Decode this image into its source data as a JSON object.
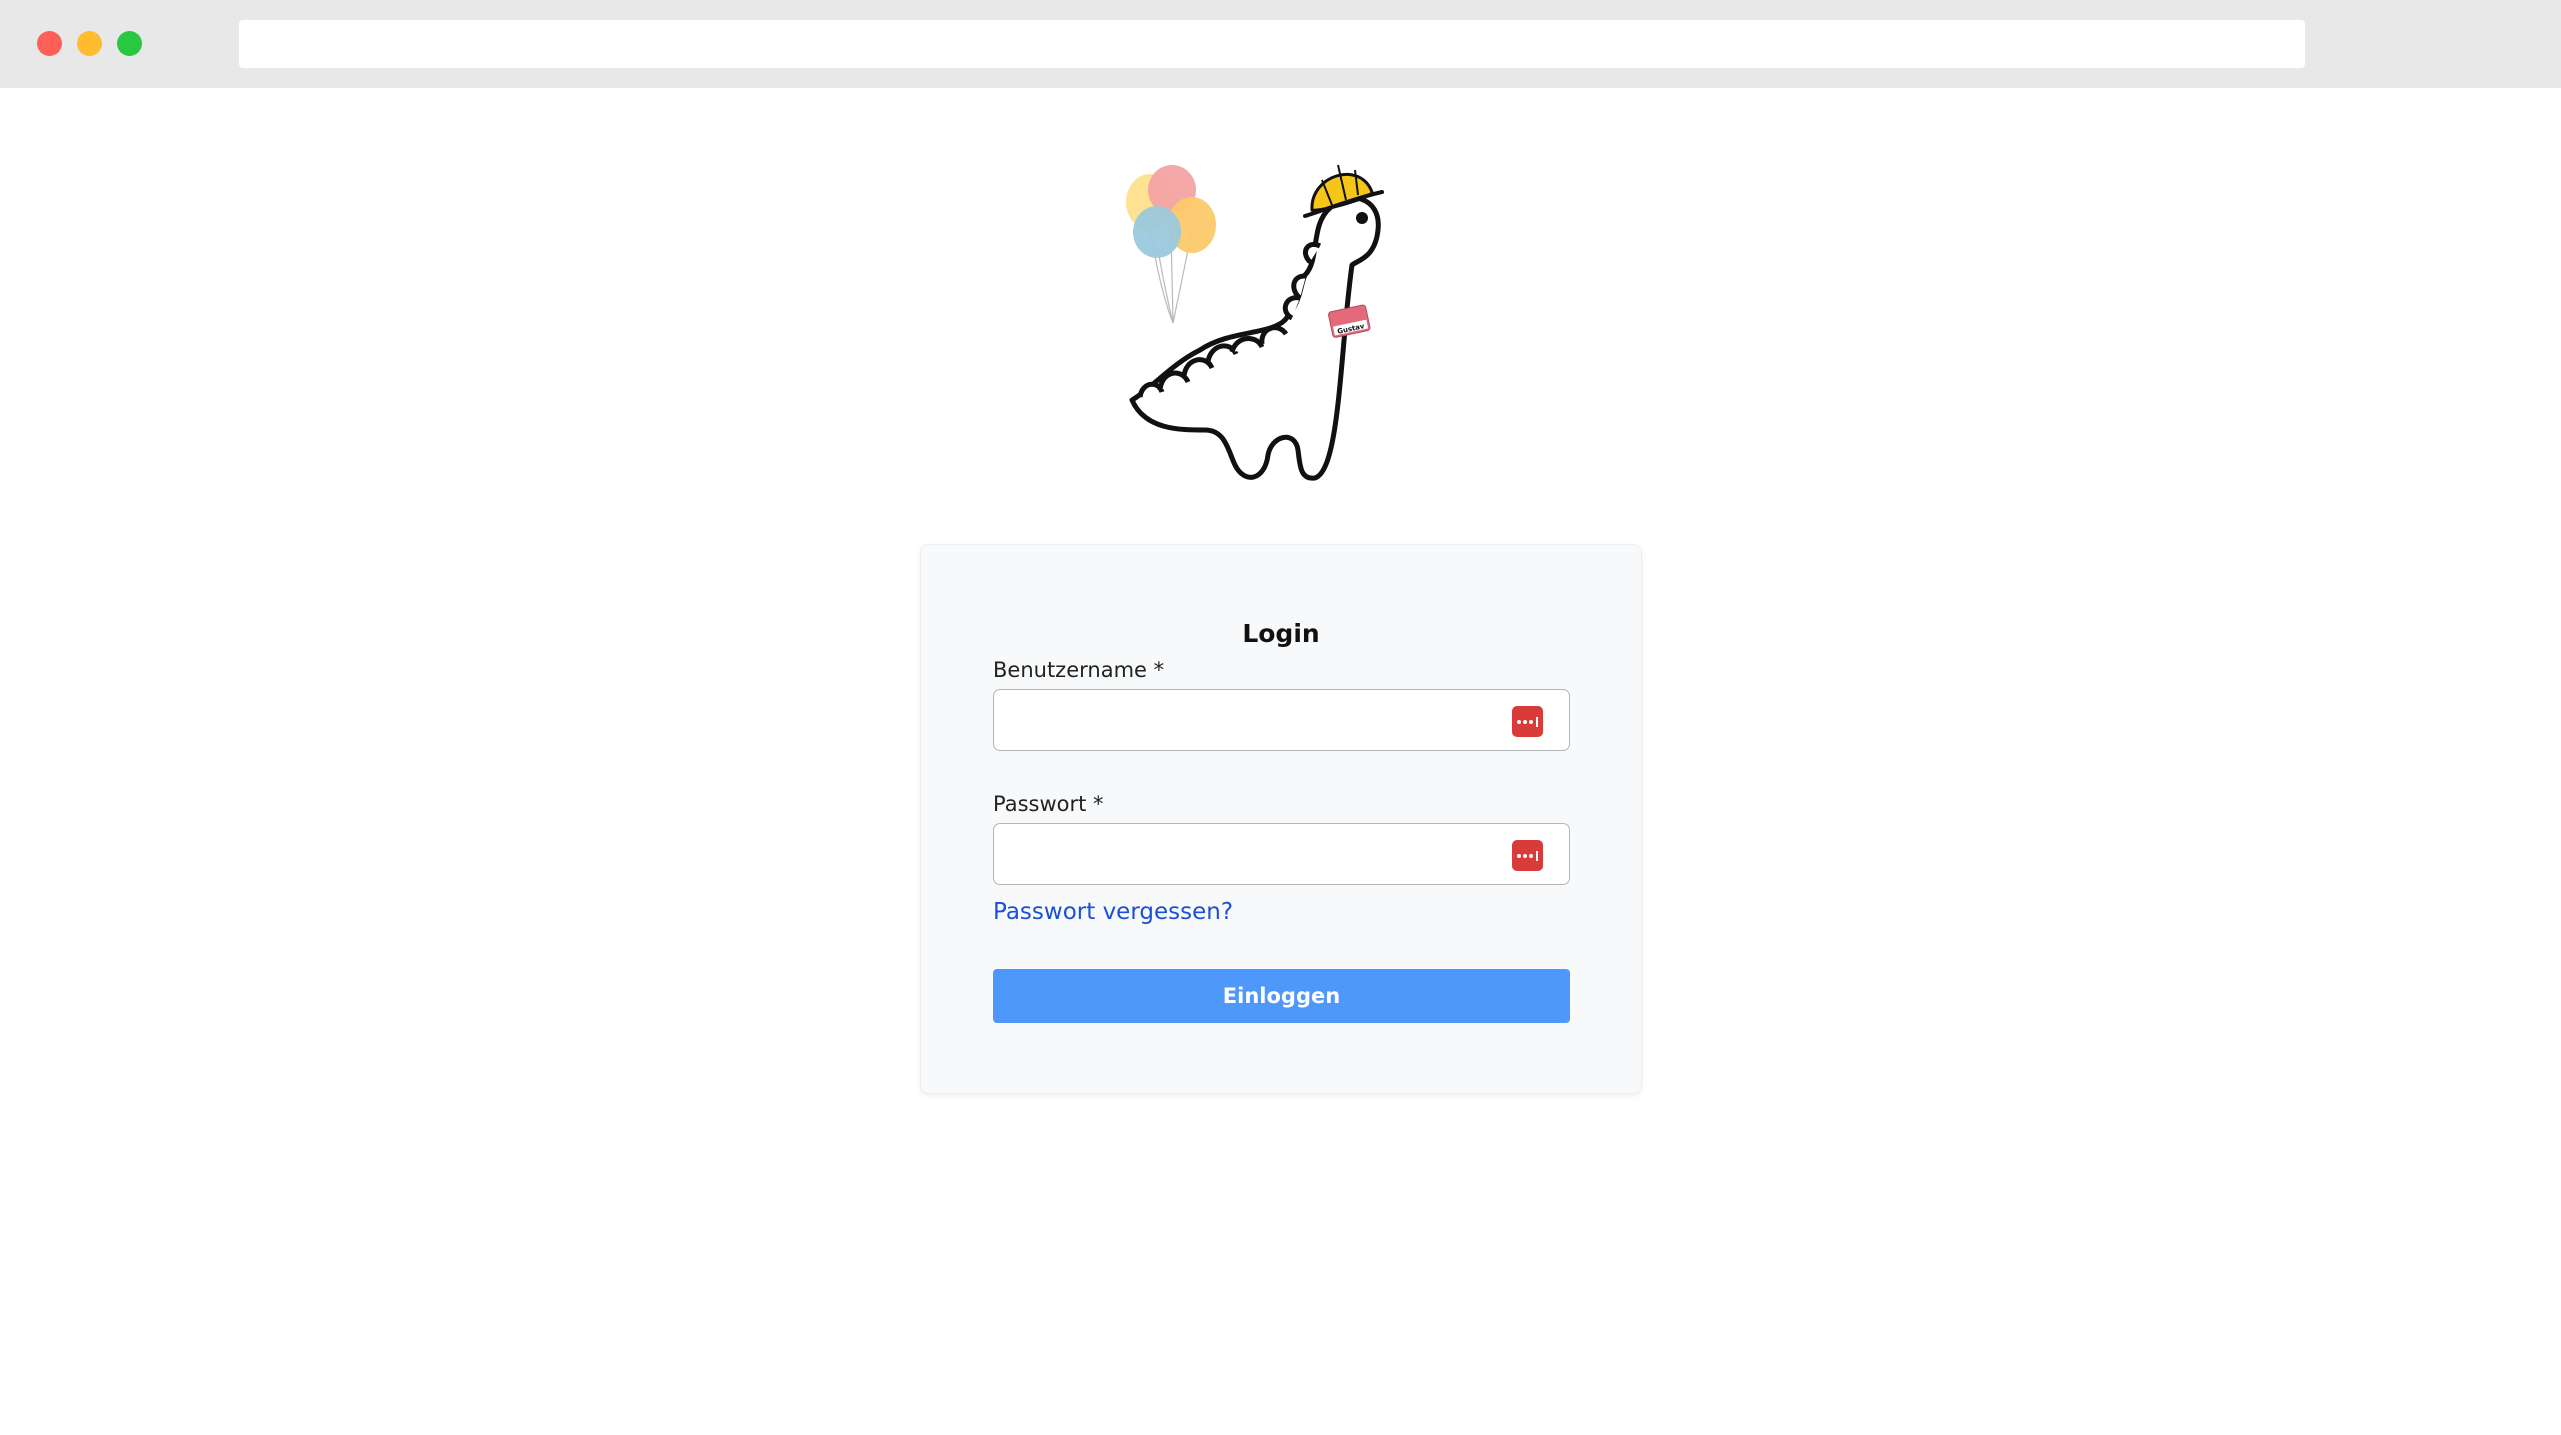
{
  "browser": {
    "address_value": ""
  },
  "login": {
    "title": "Login",
    "username_label": "Benutzername *",
    "username_value": "",
    "password_label": "Passwort *",
    "password_value": "",
    "forgot_password": "Passwort vergessen?",
    "submit_label": "Einloggen"
  },
  "logo": {
    "name_tag_text": "Gustav",
    "icon": "dinosaur-mascot-icon"
  },
  "colors": {
    "chrome": "#e8e8e8",
    "card_background": "#f8f9fa",
    "accent": "#4f98fb",
    "link": "#1a4fd6",
    "password_manager_icon": "#d93a3a"
  }
}
